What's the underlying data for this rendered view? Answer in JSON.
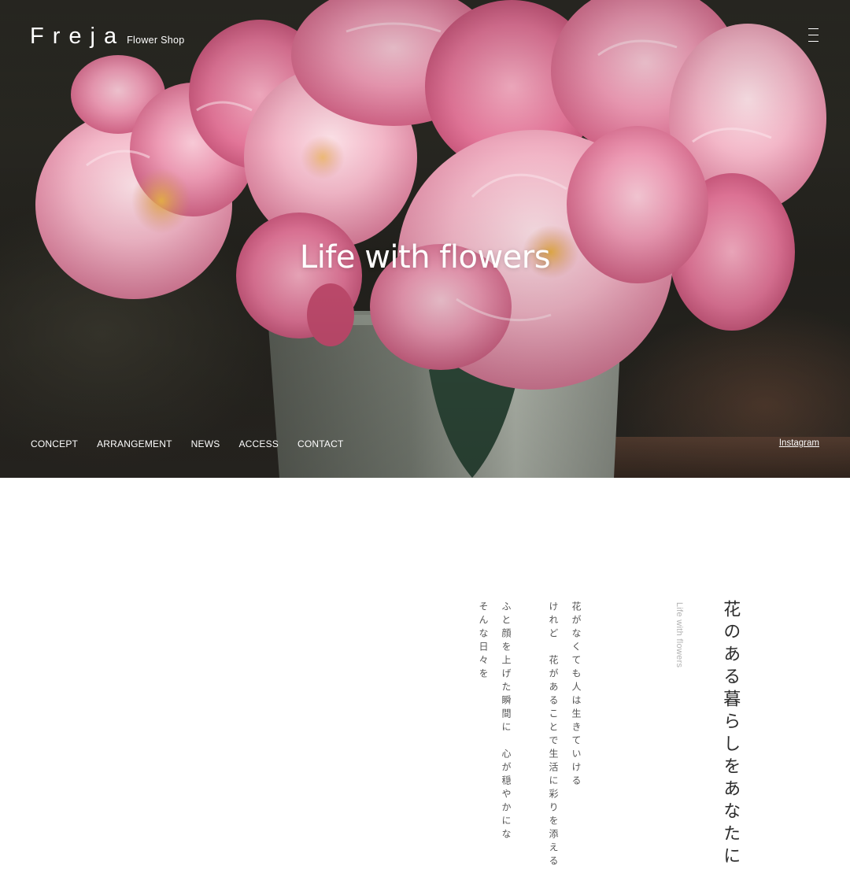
{
  "header": {
    "logo": "Freja",
    "logo_sub": "Flower Shop",
    "menu_icon": "hamburger-menu-icon"
  },
  "hero": {
    "title": "Life with flowers",
    "image": "pink-peonies-in-white-bucket"
  },
  "nav": {
    "items": [
      "CONCEPT",
      "ARRANGEMENT",
      "NEWS",
      "ACCESS",
      "CONTACT"
    ],
    "instagram": "Instagram"
  },
  "concept": {
    "heading": "花のある暮らしをあなたに",
    "label": "Life with flowers",
    "lines": [
      "花がなくても人は生きていける",
      "けれど　花があることで生活に彩りを添える",
      "ふと顔を上げた瞬間に　心が穏やかにな",
      "そんな日々を"
    ]
  },
  "colors": {
    "accent_pink": "#e88aa6",
    "text_dark": "#2c2c2c",
    "text_muted": "#b3b3b3"
  }
}
